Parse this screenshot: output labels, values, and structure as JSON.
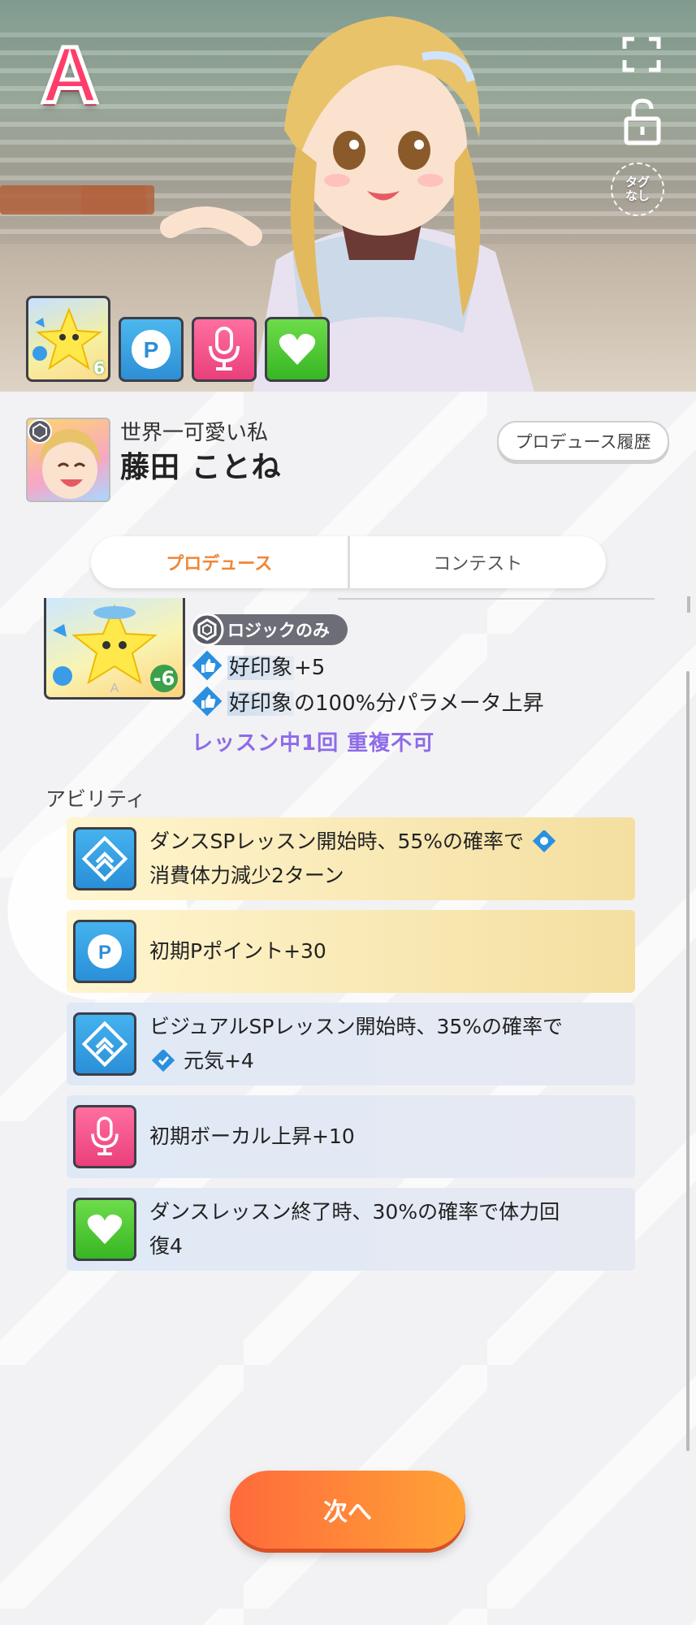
{
  "header": {
    "grade": "A",
    "tag_label_1": "タグ",
    "tag_label_2": "なし",
    "support_card_value": "6"
  },
  "profile": {
    "subtitle": "世界一可愛い私",
    "name": "藤田 ことね",
    "history_button": "プロデュース履歴"
  },
  "tabs": [
    {
      "label": "プロデュース",
      "active": true
    },
    {
      "label": "コンテスト",
      "active": false
    }
  ],
  "p_item": {
    "card_value": "-6",
    "card_letter": "A",
    "tag": "ロジックのみ",
    "effects": [
      {
        "highlight": "好印象",
        "rest": "+5"
      },
      {
        "highlight": "好印象",
        "rest": "の100%分パラメータ上昇"
      }
    ],
    "limit": "レッスン中1回 重複不可"
  },
  "abilities": {
    "title": "アビリティ",
    "items": [
      {
        "icon": "diamond-up-icon",
        "line1": "ダンスSPレッスン開始時、55%の確率で",
        "line2": "消費体力減少2ターン",
        "style": "gold"
      },
      {
        "icon": "p-point-icon",
        "line1": "初期Pポイント+30",
        "style": "gold"
      },
      {
        "icon": "diamond-up-icon",
        "line1": "ビジュアルSPレッスン開始時、35%の確率で",
        "line2": "元気+4",
        "style": "blue"
      },
      {
        "icon": "microphone-icon",
        "line1": "初期ボーカル上昇+10",
        "style": "blue"
      },
      {
        "icon": "heart-icon",
        "line1": "ダンスレッスン終了時、30%の確率で体力回",
        "line2": "復4",
        "style": "blue"
      }
    ]
  },
  "footer": {
    "next_button": "次へ"
  },
  "colors": {
    "accent_orange": "#f08636",
    "limit_purple": "#8e6be8",
    "grade_pink": "#ff3d6b"
  }
}
